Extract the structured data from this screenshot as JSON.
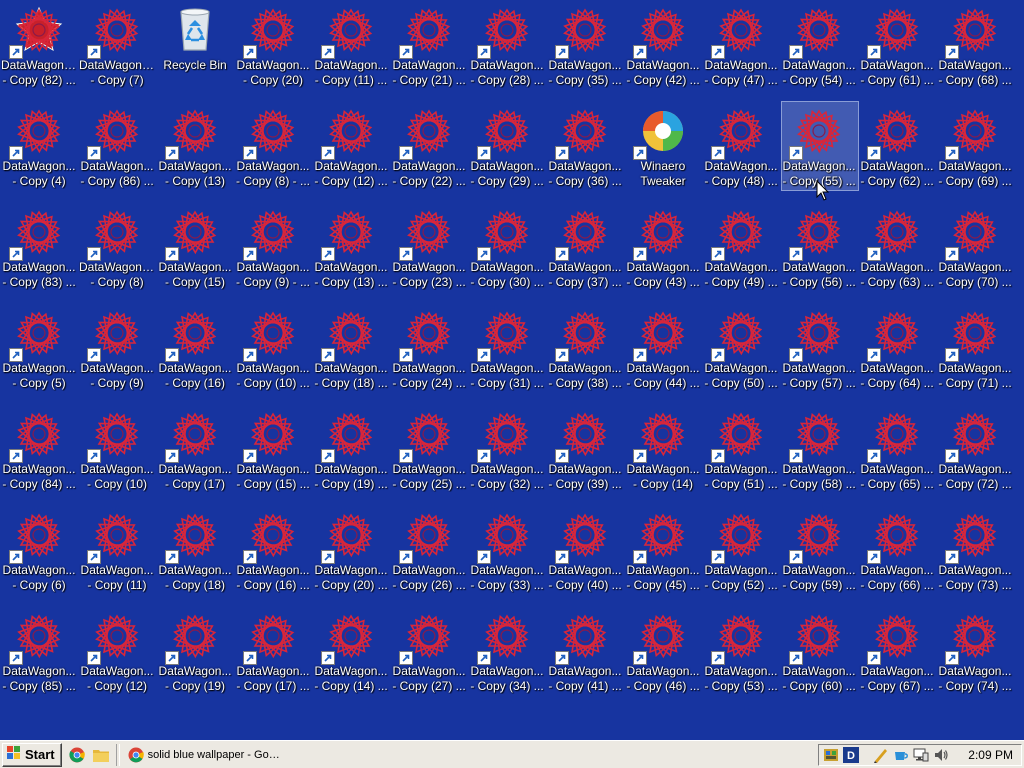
{
  "desktop": {
    "selected": "DataWagon... - Copy (55) ...",
    "rows": [
      [
        {
          "kind": "datawagon-alt",
          "line1": "DataWagon....",
          "line2": "- Copy (82) ..."
        },
        {
          "kind": "datawagon",
          "line1": "DataWagon....",
          "line2": "- Copy (7)"
        },
        {
          "kind": "recycle",
          "line1": "Recycle Bin",
          "line2": ""
        },
        {
          "kind": "datawagon",
          "line1": "DataWagon...",
          "line2": "- Copy (20)"
        },
        {
          "kind": "datawagon",
          "line1": "DataWagon...",
          "line2": "- Copy (11) ..."
        },
        {
          "kind": "datawagon",
          "line1": "DataWagon...",
          "line2": "- Copy (21) ..."
        },
        {
          "kind": "datawagon",
          "line1": "DataWagon...",
          "line2": "- Copy (28) ..."
        },
        {
          "kind": "datawagon",
          "line1": "DataWagon...",
          "line2": "- Copy (35) ..."
        },
        {
          "kind": "datawagon",
          "line1": "DataWagon...",
          "line2": "- Copy (42) ..."
        },
        {
          "kind": "datawagon",
          "line1": "DataWagon...",
          "line2": "- Copy (47) ..."
        },
        {
          "kind": "datawagon",
          "line1": "DataWagon...",
          "line2": "- Copy (54) ..."
        },
        {
          "kind": "datawagon",
          "line1": "DataWagon...",
          "line2": "- Copy (61) ..."
        },
        {
          "kind": "datawagon",
          "line1": "DataWagon...",
          "line2": "- Copy (68) ..."
        }
      ],
      [
        {
          "kind": "datawagon",
          "line1": "DataWagon...",
          "line2": "- Copy (4)"
        },
        {
          "kind": "datawagon",
          "line1": "DataWagon...",
          "line2": "- Copy (86) ..."
        },
        {
          "kind": "datawagon",
          "line1": "DataWagon...",
          "line2": "- Copy (13)"
        },
        {
          "kind": "datawagon",
          "line1": "DataWagon...",
          "line2": "- Copy (8) - ..."
        },
        {
          "kind": "datawagon",
          "line1": "DataWagon...",
          "line2": "- Copy (12) ..."
        },
        {
          "kind": "datawagon",
          "line1": "DataWagon...",
          "line2": "- Copy (22) ..."
        },
        {
          "kind": "datawagon",
          "line1": "DataWagon...",
          "line2": "- Copy (29) ..."
        },
        {
          "kind": "datawagon",
          "line1": "DataWagon...",
          "line2": "- Copy (36) ..."
        },
        {
          "kind": "winaero",
          "line1": "Winaero",
          "line2": "Tweaker"
        },
        {
          "kind": "datawagon",
          "line1": "DataWagon...",
          "line2": "- Copy (48) ..."
        },
        {
          "kind": "datawagon",
          "line1": "DataWagon...",
          "line2": "- Copy (55) ...",
          "selected": true
        },
        {
          "kind": "datawagon",
          "line1": "DataWagon...",
          "line2": "- Copy (62) ..."
        },
        {
          "kind": "datawagon",
          "line1": "DataWagon...",
          "line2": "- Copy (69) ..."
        }
      ],
      [
        {
          "kind": "datawagon",
          "line1": "DataWagon...",
          "line2": "- Copy (83) ..."
        },
        {
          "kind": "datawagon",
          "line1": "DataWagon....",
          "line2": "- Copy (8)"
        },
        {
          "kind": "datawagon",
          "line1": "DataWagon...",
          "line2": "- Copy (15)"
        },
        {
          "kind": "datawagon",
          "line1": "DataWagon...",
          "line2": "- Copy (9) - ..."
        },
        {
          "kind": "datawagon",
          "line1": "DataWagon...",
          "line2": "- Copy (13) ..."
        },
        {
          "kind": "datawagon",
          "line1": "DataWagon...",
          "line2": "- Copy (23) ..."
        },
        {
          "kind": "datawagon",
          "line1": "DataWagon...",
          "line2": "- Copy (30) ..."
        },
        {
          "kind": "datawagon",
          "line1": "DataWagon...",
          "line2": "- Copy (37) ..."
        },
        {
          "kind": "datawagon",
          "line1": "DataWagon...",
          "line2": "- Copy (43) ..."
        },
        {
          "kind": "datawagon",
          "line1": "DataWagon...",
          "line2": "- Copy (49) ..."
        },
        {
          "kind": "datawagon",
          "line1": "DataWagon...",
          "line2": "- Copy (56) ..."
        },
        {
          "kind": "datawagon",
          "line1": "DataWagon...",
          "line2": "- Copy (63) ..."
        },
        {
          "kind": "datawagon",
          "line1": "DataWagon...",
          "line2": "- Copy (70) ..."
        }
      ],
      [
        {
          "kind": "datawagon",
          "line1": "DataWagon...",
          "line2": "- Copy (5)"
        },
        {
          "kind": "datawagon",
          "line1": "DataWagon...",
          "line2": "- Copy (9)"
        },
        {
          "kind": "datawagon",
          "line1": "DataWagon...",
          "line2": "- Copy (16)"
        },
        {
          "kind": "datawagon",
          "line1": "DataWagon...",
          "line2": "- Copy (10) ..."
        },
        {
          "kind": "datawagon",
          "line1": "DataWagon...",
          "line2": "- Copy (18) ..."
        },
        {
          "kind": "datawagon",
          "line1": "DataWagon...",
          "line2": "- Copy (24) ..."
        },
        {
          "kind": "datawagon",
          "line1": "DataWagon...",
          "line2": "- Copy (31) ..."
        },
        {
          "kind": "datawagon",
          "line1": "DataWagon...",
          "line2": "- Copy (38) ..."
        },
        {
          "kind": "datawagon",
          "line1": "DataWagon...",
          "line2": "- Copy (44) ..."
        },
        {
          "kind": "datawagon",
          "line1": "DataWagon...",
          "line2": "- Copy (50) ..."
        },
        {
          "kind": "datawagon",
          "line1": "DataWagon...",
          "line2": "- Copy (57) ..."
        },
        {
          "kind": "datawagon",
          "line1": "DataWagon...",
          "line2": "- Copy (64) ..."
        },
        {
          "kind": "datawagon",
          "line1": "DataWagon...",
          "line2": "- Copy (71) ..."
        }
      ],
      [
        {
          "kind": "datawagon",
          "line1": "DataWagon...",
          "line2": "- Copy (84) ..."
        },
        {
          "kind": "datawagon",
          "line1": "DataWagon...",
          "line2": "- Copy (10)"
        },
        {
          "kind": "datawagon",
          "line1": "DataWagon...",
          "line2": "- Copy (17)"
        },
        {
          "kind": "datawagon",
          "line1": "DataWagon...",
          "line2": "- Copy (15) ..."
        },
        {
          "kind": "datawagon",
          "line1": "DataWagon...",
          "line2": "- Copy (19) ..."
        },
        {
          "kind": "datawagon",
          "line1": "DataWagon...",
          "line2": "- Copy (25) ..."
        },
        {
          "kind": "datawagon",
          "line1": "DataWagon...",
          "line2": "- Copy (32) ..."
        },
        {
          "kind": "datawagon",
          "line1": "DataWagon...",
          "line2": "- Copy (39) ..."
        },
        {
          "kind": "datawagon",
          "line1": "DataWagon...",
          "line2": "- Copy (14)"
        },
        {
          "kind": "datawagon",
          "line1": "DataWagon...",
          "line2": "- Copy (51) ..."
        },
        {
          "kind": "datawagon",
          "line1": "DataWagon...",
          "line2": "- Copy (58) ..."
        },
        {
          "kind": "datawagon",
          "line1": "DataWagon...",
          "line2": "- Copy (65) ..."
        },
        {
          "kind": "datawagon",
          "line1": "DataWagon...",
          "line2": "- Copy (72) ..."
        }
      ],
      [
        {
          "kind": "datawagon",
          "line1": "DataWagon...",
          "line2": "- Copy (6)"
        },
        {
          "kind": "datawagon",
          "line1": "DataWagon...",
          "line2": "- Copy (11)"
        },
        {
          "kind": "datawagon",
          "line1": "DataWagon...",
          "line2": "- Copy (18)"
        },
        {
          "kind": "datawagon",
          "line1": "DataWagon...",
          "line2": "- Copy (16) ..."
        },
        {
          "kind": "datawagon",
          "line1": "DataWagon...",
          "line2": "- Copy (20) ..."
        },
        {
          "kind": "datawagon",
          "line1": "DataWagon...",
          "line2": "- Copy (26) ..."
        },
        {
          "kind": "datawagon",
          "line1": "DataWagon...",
          "line2": "- Copy (33) ..."
        },
        {
          "kind": "datawagon",
          "line1": "DataWagon...",
          "line2": "- Copy (40) ..."
        },
        {
          "kind": "datawagon",
          "line1": "DataWagon...",
          "line2": "- Copy (45) ..."
        },
        {
          "kind": "datawagon",
          "line1": "DataWagon...",
          "line2": "- Copy (52) ..."
        },
        {
          "kind": "datawagon",
          "line1": "DataWagon...",
          "line2": "- Copy (59) ..."
        },
        {
          "kind": "datawagon",
          "line1": "DataWagon...",
          "line2": "- Copy (66) ..."
        },
        {
          "kind": "datawagon",
          "line1": "DataWagon...",
          "line2": "- Copy (73) ..."
        }
      ],
      [
        {
          "kind": "datawagon",
          "line1": "DataWagon...",
          "line2": "- Copy (85) ..."
        },
        {
          "kind": "datawagon",
          "line1": "DataWagon...",
          "line2": "- Copy (12)"
        },
        {
          "kind": "datawagon",
          "line1": "DataWagon...",
          "line2": "- Copy (19)"
        },
        {
          "kind": "datawagon",
          "line1": "DataWagon...",
          "line2": "- Copy (17) ..."
        },
        {
          "kind": "datawagon",
          "line1": "DataWagon...",
          "line2": "- Copy (14) ..."
        },
        {
          "kind": "datawagon",
          "line1": "DataWagon...",
          "line2": "- Copy (27) ..."
        },
        {
          "kind": "datawagon",
          "line1": "DataWagon...",
          "line2": "- Copy (34) ..."
        },
        {
          "kind": "datawagon",
          "line1": "DataWagon...",
          "line2": "- Copy (41) ..."
        },
        {
          "kind": "datawagon",
          "line1": "DataWagon...",
          "line2": "- Copy (46) ..."
        },
        {
          "kind": "datawagon",
          "line1": "DataWagon...",
          "line2": "- Copy (53) ..."
        },
        {
          "kind": "datawagon",
          "line1": "DataWagon...",
          "line2": "- Copy (60) ..."
        },
        {
          "kind": "datawagon",
          "line1": "DataWagon...",
          "line2": "- Copy (67) ..."
        },
        {
          "kind": "datawagon",
          "line1": "DataWagon...",
          "line2": "- Copy (74) ..."
        }
      ]
    ]
  },
  "taskbar": {
    "start_label": "Start",
    "quick_launch": [
      {
        "icon": "chrome-icon"
      },
      {
        "icon": "folder-icon"
      }
    ],
    "task_button_label": "solid blue wallpaper - Goo...",
    "tray_icons": [
      "network-tray-icon",
      "d-app-tray-icon",
      "pen-tray-icon",
      "cup-tray-icon",
      "monitor-tray-icon",
      "volume-tray-icon"
    ],
    "clock": "2:09 PM"
  },
  "colors": {
    "desktop_bg": "#1734a0",
    "icon_star": "#d8263a",
    "taskbar": "#ece9e2"
  }
}
